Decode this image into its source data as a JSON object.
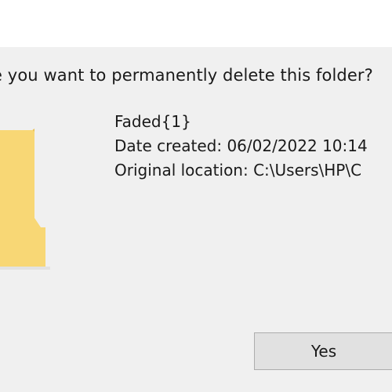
{
  "dialog": {
    "question": "e you want to permanently delete this folder?",
    "item": {
      "name": "Faded{1}",
      "date_created": "Date created: 06/02/2022 10:14",
      "original_location": "Original location: C:\\Users\\HP\\C"
    },
    "icon": "folder-icon",
    "buttons": {
      "yes_label": "Yes"
    }
  },
  "colors": {
    "content_bg": "#f0f0f0",
    "titlebar_bg": "#ffffff",
    "folder_main": "#f8d775",
    "folder_back": "#e8bf4f",
    "button_bg": "#e1e1e1",
    "button_border": "#adadad"
  }
}
